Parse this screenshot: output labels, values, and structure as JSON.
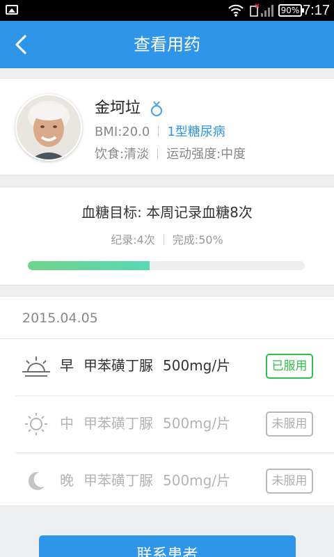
{
  "status_bar": {
    "battery": "90%",
    "time": "7:17",
    "icons": [
      "image-notification-icon",
      "wifi-icon",
      "signal-icon",
      "battery-icon"
    ]
  },
  "header": {
    "title": "查看用药",
    "back_icon": "chevron-left-icon"
  },
  "patient": {
    "name": "金坷垃",
    "gender_icon": "female-icon",
    "bmi": "BMI:20.0",
    "diagnosis": "1型糖尿病",
    "diet": "饮食:清淡",
    "exercise": "运动强度:中度"
  },
  "goal": {
    "title": "血糖目标:  本周记录血糖8次",
    "recorded": "纪录:4次",
    "completion": "完成:50%",
    "progress": 0.5
  },
  "medication": {
    "date": "2015.04.05",
    "items": [
      {
        "time": "早",
        "drug": "甲苯磺丁脲",
        "dose": "500mg/片",
        "status": "已服用",
        "icon": "sunrise-icon",
        "taken": true
      },
      {
        "time": "中",
        "drug": "甲苯磺丁脲",
        "dose": "500mg/片",
        "status": "未服用",
        "icon": "sun-icon",
        "taken": false
      },
      {
        "time": "晚",
        "drug": "甲苯磺丁脲",
        "dose": "500mg/片",
        "status": "未服用",
        "icon": "moon-icon",
        "taken": false
      }
    ]
  },
  "contact_button": "联系患者",
  "colors": {
    "primary": "#2f95e8",
    "taken": "#2fbf4a",
    "untaken": "#b8b8b8",
    "progress": "#6fd389"
  }
}
